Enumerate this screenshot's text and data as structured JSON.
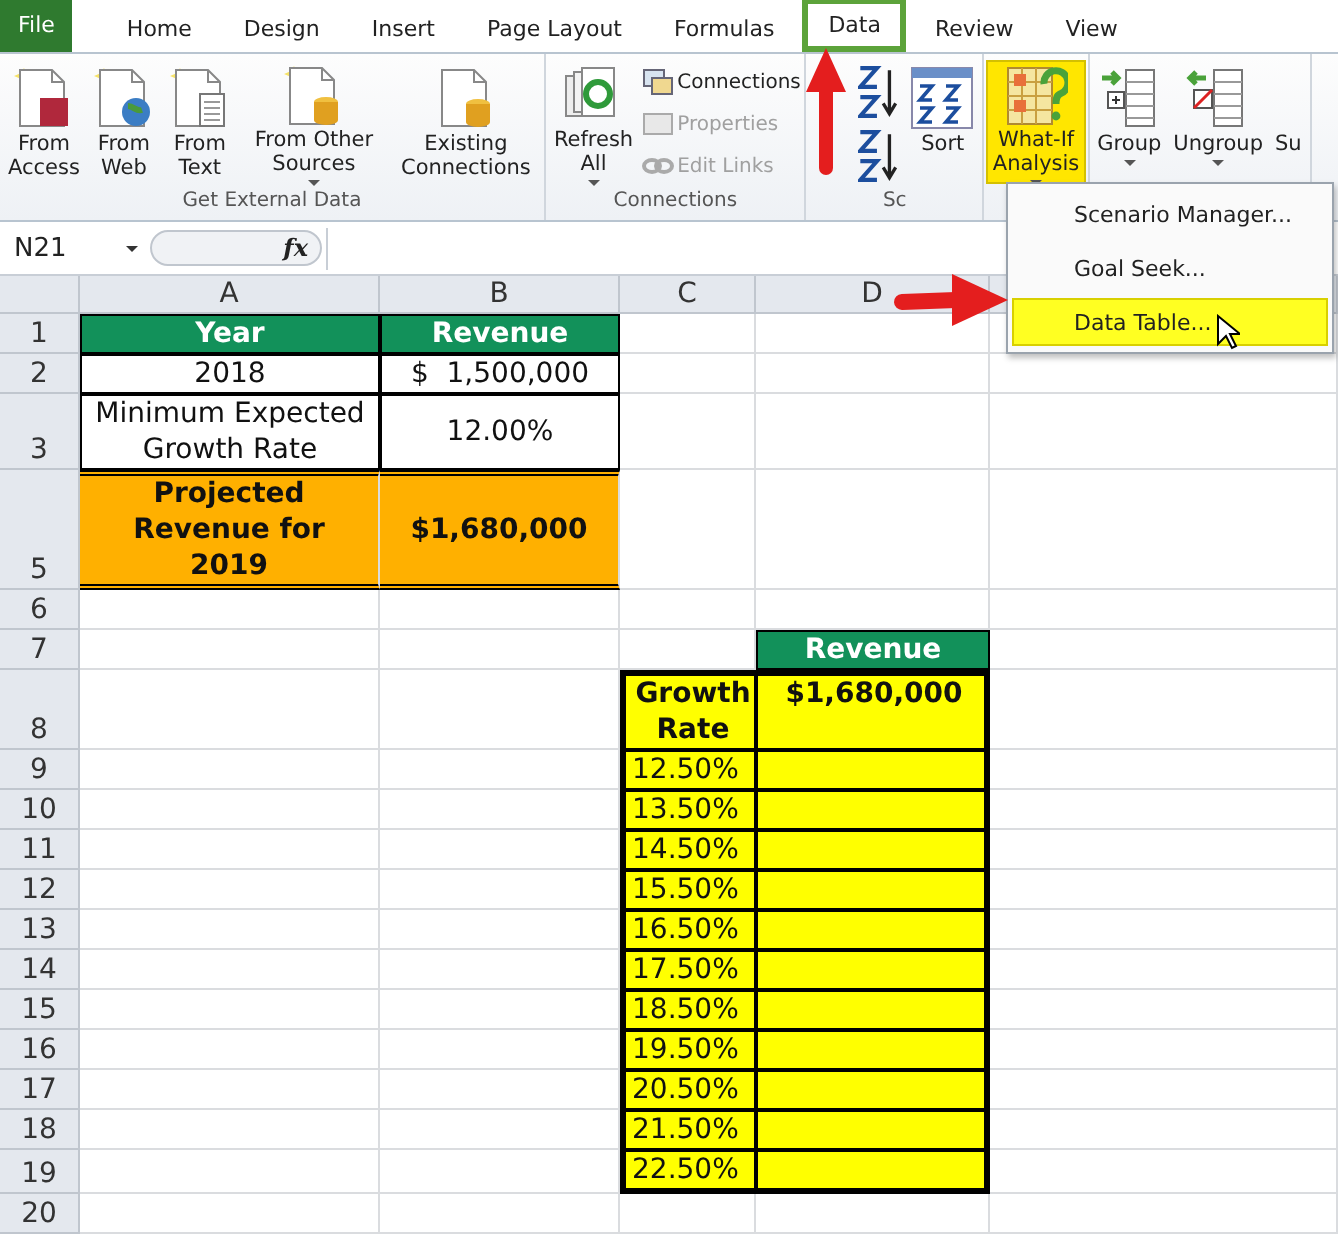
{
  "tabs": [
    {
      "label": "File",
      "kind": "file",
      "selected": false
    },
    {
      "label": "Home",
      "kind": "tab",
      "selected": false
    },
    {
      "label": "Design",
      "kind": "tab",
      "selected": false
    },
    {
      "label": "Insert",
      "kind": "tab",
      "selected": false
    },
    {
      "label": "Page Layout",
      "kind": "tab",
      "selected": false
    },
    {
      "label": "Formulas",
      "kind": "tab",
      "selected": false
    },
    {
      "label": "Data",
      "kind": "tab",
      "selected": true
    },
    {
      "label": "Review",
      "kind": "tab",
      "selected": false
    },
    {
      "label": "View",
      "kind": "tab",
      "selected": false
    }
  ],
  "ribbon_groups": [
    {
      "label": "Get External Data",
      "buttons": [
        {
          "kind": "large",
          "label": "From Access"
        },
        {
          "kind": "large",
          "label": "From Web"
        },
        {
          "kind": "large",
          "label": "From Text"
        },
        {
          "kind": "large",
          "label": "From Other Sources",
          "has_menu": true
        },
        {
          "kind": "large",
          "label": "Existing Connections"
        }
      ]
    },
    {
      "label": "Connections",
      "buttons": [
        {
          "kind": "large",
          "label": "Refresh All",
          "has_menu": true
        },
        {
          "kind": "small",
          "label": "Connections",
          "disabled": false
        },
        {
          "kind": "small",
          "label": "Properties",
          "disabled": true
        },
        {
          "kind": "small",
          "label": "Edit Links",
          "disabled": true
        }
      ]
    },
    {
      "label": "Sc",
      "buttons": [
        {
          "kind": "icon"
        },
        {
          "kind": "icon"
        },
        {
          "kind": "large",
          "label": "Sort"
        }
      ]
    },
    {
      "buttons": [
        {
          "kind": "large",
          "label": "What-If Analysis",
          "has_menu": true,
          "highlighted": true
        }
      ]
    },
    {
      "buttons": [
        {
          "kind": "large",
          "label": "Group",
          "has_menu": true
        },
        {
          "kind": "large",
          "label": "Ungroup",
          "has_menu": true
        },
        {
          "kind": "large",
          "label": "Su"
        }
      ]
    }
  ],
  "formula_bar": {
    "name_box": "N21",
    "function_label": "fx"
  },
  "sheet": {
    "columns": [
      "A",
      "B",
      "C",
      "D",
      ""
    ],
    "rows": [
      {
        "number": "1",
        "cells": [
          {
            "kind": "header",
            "text": "Year"
          },
          {
            "kind": "header",
            "text": "Revenue"
          }
        ]
      },
      {
        "number": "2",
        "cells": [
          {
            "kind": "plain",
            "text": "2018"
          },
          {
            "kind": "plain",
            "text": "$  1,500,000"
          }
        ]
      },
      {
        "number": "3",
        "cells": [
          {
            "kind": "plain",
            "text": "Minimum Expected Growth Rate"
          },
          {
            "kind": "plain",
            "text": "12.00%"
          }
        ]
      },
      {
        "number": "5",
        "cells": [
          {
            "kind": "total",
            "text": "Projected Revenue for 2019"
          },
          {
            "kind": "total",
            "text": "$1,680,000"
          }
        ]
      },
      {
        "number": "6",
        "cells": []
      },
      {
        "number": "7",
        "cells": [
          {
            "kind": "blank"
          },
          {
            "kind": "blank"
          },
          {
            "kind": "blank"
          },
          {
            "kind": "header",
            "text": "Revenue"
          }
        ]
      },
      {
        "number": "8",
        "cells": [
          {
            "kind": "blank"
          },
          {
            "kind": "blank"
          },
          {
            "kind": "input-head",
            "text": "Growth Rate"
          },
          {
            "kind": "input-head",
            "text": "$1,680,000"
          }
        ]
      },
      {
        "number": "9",
        "cells": [
          {
            "kind": "blank"
          },
          {
            "kind": "blank"
          },
          {
            "kind": "input",
            "text": "12.50%"
          },
          {
            "kind": "input"
          }
        ]
      },
      {
        "number": "10",
        "cells": [
          {
            "kind": "blank"
          },
          {
            "kind": "blank"
          },
          {
            "kind": "input",
            "text": "13.50%"
          },
          {
            "kind": "input"
          }
        ]
      },
      {
        "number": "11",
        "cells": [
          {
            "kind": "blank"
          },
          {
            "kind": "blank"
          },
          {
            "kind": "input",
            "text": "14.50%"
          },
          {
            "kind": "input"
          }
        ]
      },
      {
        "number": "12",
        "cells": [
          {
            "kind": "blank"
          },
          {
            "kind": "blank"
          },
          {
            "kind": "input",
            "text": "15.50%"
          },
          {
            "kind": "input"
          }
        ]
      },
      {
        "number": "13",
        "cells": [
          {
            "kind": "blank"
          },
          {
            "kind": "blank"
          },
          {
            "kind": "input",
            "text": "16.50%"
          },
          {
            "kind": "input"
          }
        ]
      },
      {
        "number": "14",
        "cells": [
          {
            "kind": "blank"
          },
          {
            "kind": "blank"
          },
          {
            "kind": "input",
            "text": "17.50%"
          },
          {
            "kind": "input"
          }
        ]
      },
      {
        "number": "15",
        "cells": [
          {
            "kind": "blank"
          },
          {
            "kind": "blank"
          },
          {
            "kind": "input",
            "text": "18.50%"
          },
          {
            "kind": "input"
          }
        ]
      },
      {
        "number": "16",
        "cells": [
          {
            "kind": "blank"
          },
          {
            "kind": "blank"
          },
          {
            "kind": "input",
            "text": "19.50%"
          },
          {
            "kind": "input"
          }
        ]
      },
      {
        "number": "17",
        "cells": [
          {
            "kind": "blank"
          },
          {
            "kind": "blank"
          },
          {
            "kind": "input",
            "text": "20.50%"
          },
          {
            "kind": "input"
          }
        ]
      },
      {
        "number": "18",
        "cells": [
          {
            "kind": "blank"
          },
          {
            "kind": "blank"
          },
          {
            "kind": "input",
            "text": "21.50%"
          },
          {
            "kind": "input"
          }
        ]
      },
      {
        "number": "19",
        "cells": [
          {
            "kind": "blank"
          },
          {
            "kind": "blank"
          },
          {
            "kind": "input",
            "text": "22.50%"
          },
          {
            "kind": "input"
          }
        ]
      },
      {
        "number": "20",
        "cells": []
      }
    ]
  },
  "dropdown_menu": {
    "items": [
      {
        "label": "Scenario Manager...",
        "selected": false
      },
      {
        "label": "Goal Seek...",
        "selected": false
      },
      {
        "label": "Data Table...",
        "selected": true
      }
    ]
  }
}
